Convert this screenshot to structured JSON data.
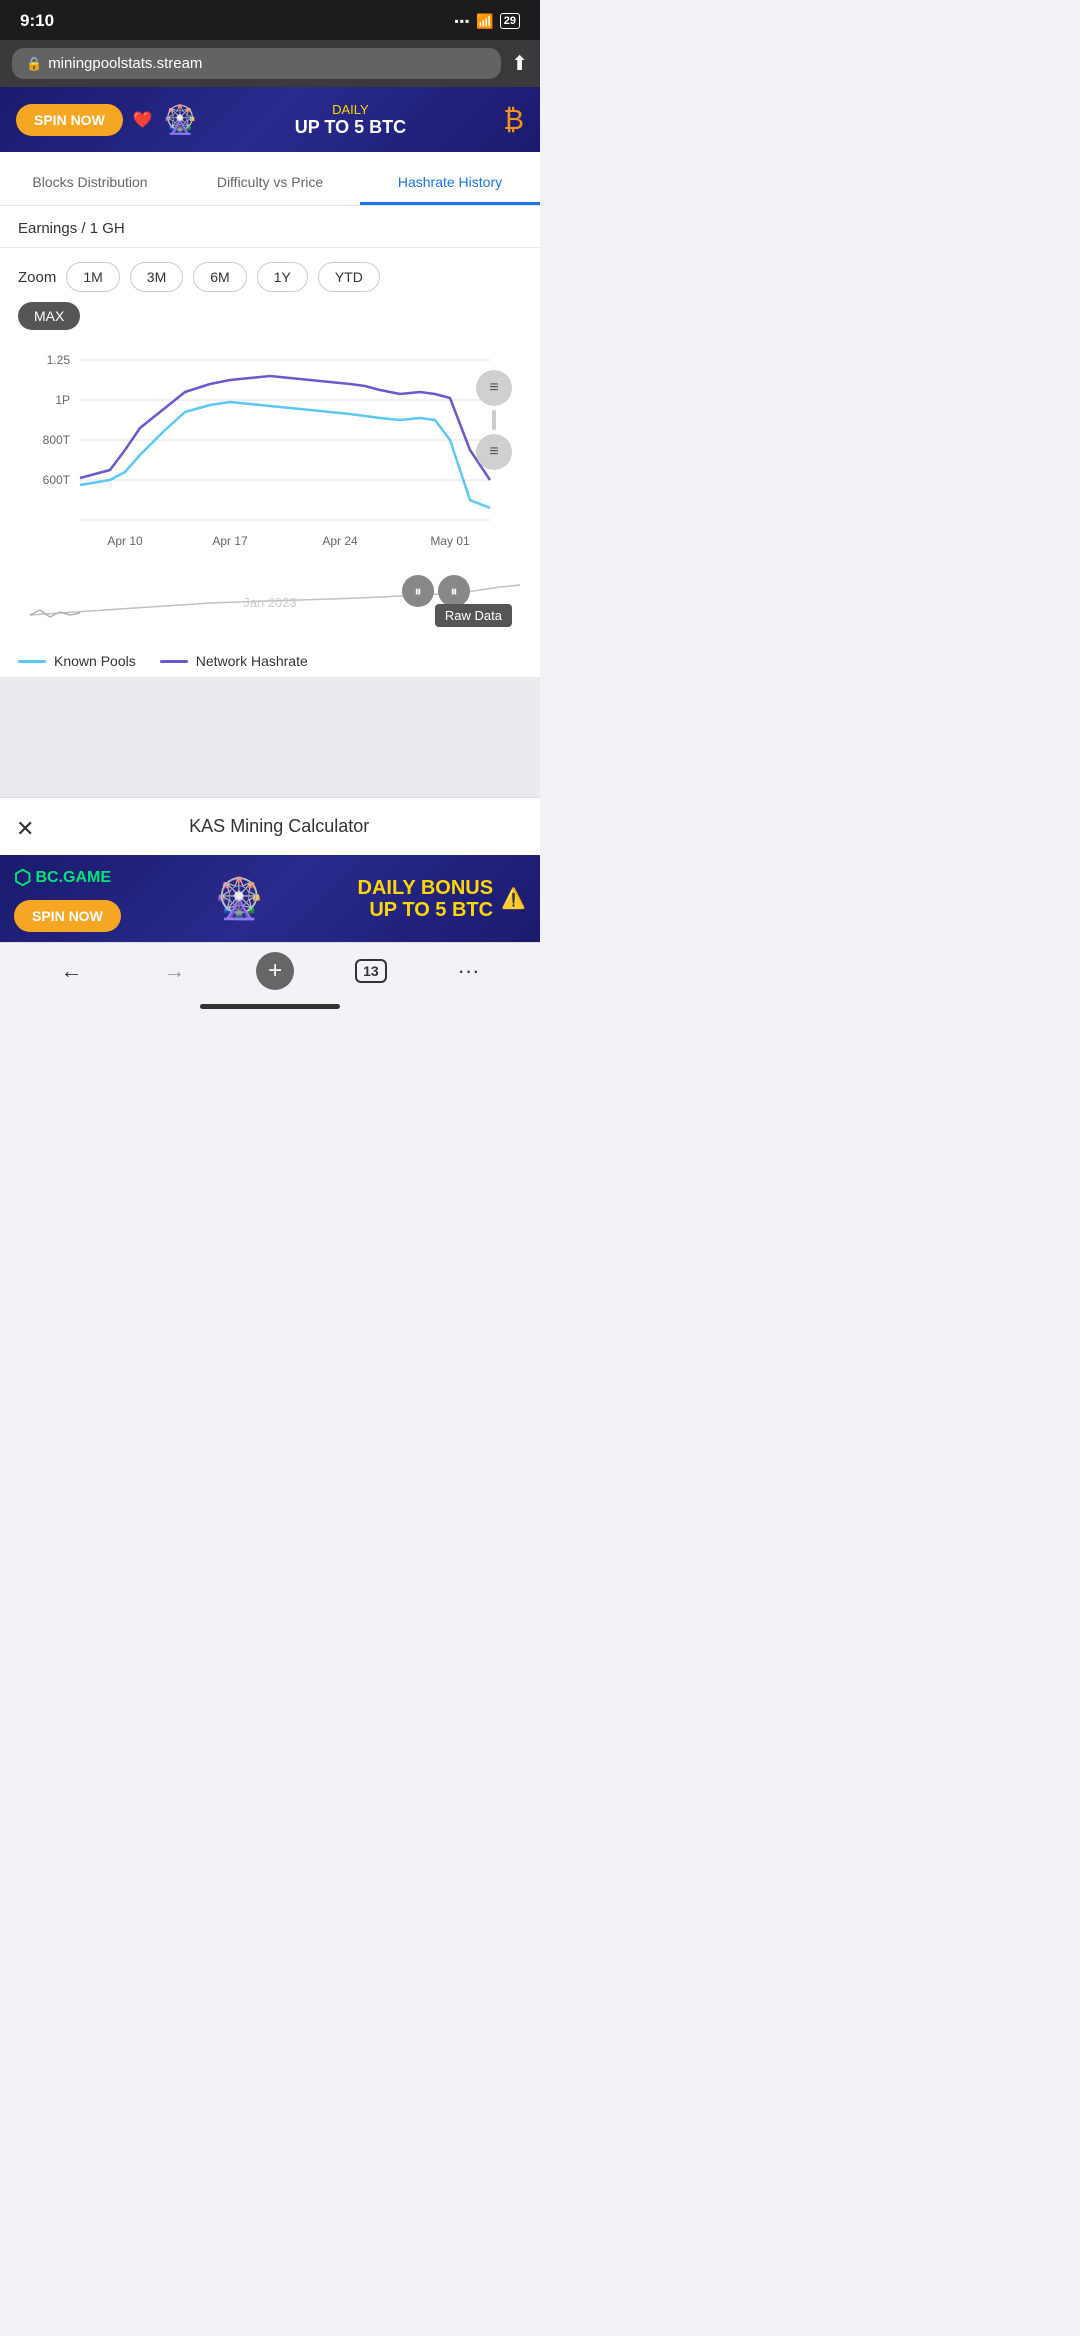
{
  "statusBar": {
    "time": "9:10",
    "battery": "29"
  },
  "browser": {
    "url": "miningpoolstats.stream",
    "share_label": "⬆"
  },
  "adTop": {
    "spin_label": "SPIN NOW",
    "main_text": "UP TO 5 BTC",
    "sub_text": "DAILY"
  },
  "tabs": [
    {
      "id": "blocks",
      "label": "Blocks Distribution",
      "active": false
    },
    {
      "id": "difficulty",
      "label": "Difficulty vs Price",
      "active": false
    },
    {
      "id": "hashrate",
      "label": "Hashrate History",
      "active": true
    }
  ],
  "earnings": {
    "label": "Earnings / 1 GH"
  },
  "zoom": {
    "label": "Zoom",
    "buttons": [
      "1M",
      "3M",
      "6M",
      "1Y",
      "YTD"
    ],
    "max_label": "MAX"
  },
  "chart": {
    "y_labels": [
      "1.25",
      "1P",
      "800T",
      "600T"
    ],
    "x_labels": [
      "Apr 10",
      "Apr 17",
      "Apr 24",
      "May 01"
    ],
    "lower_label": "Jan 2023",
    "raw_data_label": "Raw Data"
  },
  "legend": {
    "known_pools": "Known Pools",
    "network_hashrate": "Network Hashrate"
  },
  "bottomPanel": {
    "title": "KAS Mining Calculator",
    "close_icon": "✕"
  },
  "adBottom": {
    "logo": "BC.GAME",
    "spin_label": "SPIN NOW",
    "main_text": "DAILY BONUS\nUP TO 5 BTC"
  },
  "browserNav": {
    "back_label": "←",
    "forward_label": "→",
    "plus_label": "+",
    "tab_count": "13",
    "more_label": "···"
  }
}
